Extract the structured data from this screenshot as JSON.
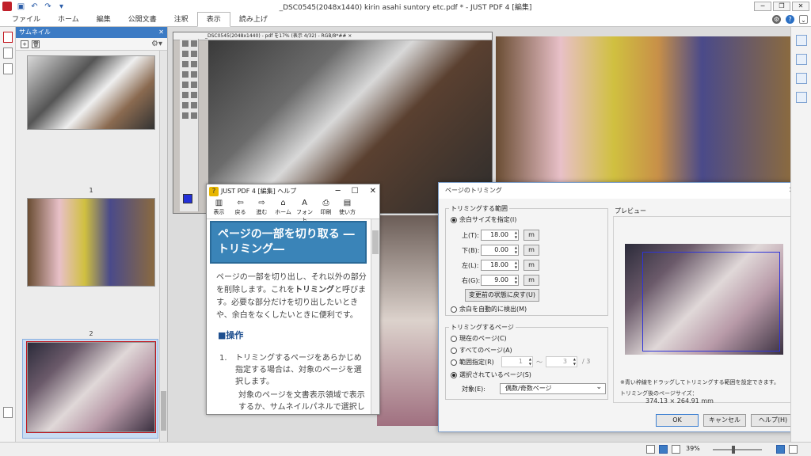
{
  "window": {
    "title": "_DSC0545(2048x1440) kirin asahi suntory etc.pdf * - JUST PDF 4 [編集]"
  },
  "ribbon": {
    "tabs": [
      {
        "label": "ファイル"
      },
      {
        "label": "ホーム"
      },
      {
        "label": "編集"
      },
      {
        "label": "公開文書"
      },
      {
        "label": "注釈"
      },
      {
        "label": "表示"
      },
      {
        "label": "読み上げ"
      }
    ],
    "active_tab": "表示"
  },
  "thumbnail_panel": {
    "title": "サムネイル",
    "pages": [
      {
        "label": "1"
      },
      {
        "label": "2"
      }
    ]
  },
  "image_window": {
    "title": "_DSC0545(2048x1440) - pdf を17% (表示 4/32) - RGB/8*##  ×"
  },
  "help_window": {
    "title": "JUST PDF 4 [編集] ヘルプ",
    "toolbar": [
      "表示",
      "戻る",
      "進む",
      "ホーム",
      "フォント",
      "印刷",
      "使い方"
    ],
    "heading": "ページの一部を切り取る ―トリミング―",
    "intro_pre": "ページの一部を切り出し、それ以外の部分を削除します。これを",
    "intro_bold": "トリミング",
    "intro_post": "と呼びます。必要な部分だけを切り出したいときや、余白をなくしたいときに便利です。",
    "section": "■操作",
    "step_num": "1.",
    "step_text": "トリミングするページをあらかじめ指定する場合は、対象のページを選択します。",
    "sub_text": "対象のページを文書表示領域で表示するか、サムネイルパネルで選択します。→ 詳く"
  },
  "trim_dialog": {
    "title": "ページのトリミング",
    "range_group": "トリミングする範囲",
    "opt_margin": "余白サイズを指定(I)",
    "top_label": "上(T):",
    "top_value": "18.00",
    "bottom_label": "下(B):",
    "bottom_value": "0.00",
    "left_label": "左(L):",
    "left_value": "18.00",
    "right_label": "右(G):",
    "right_value": "9.00",
    "unit": "m",
    "reset_button": "変更前の状態に戻す(U)",
    "opt_auto": "余白を自動的に検出(M)",
    "pages_group": "トリミングするページ",
    "opt_current": "現在のページ(C)",
    "opt_all": "すべてのページ(A)",
    "opt_range": "範囲指定(R)",
    "range_from": "1",
    "range_tilde": "～",
    "range_to": "3",
    "range_total": "/ 3",
    "opt_selected": "選択されているページ(S)",
    "target_label": "対象(E):",
    "target_value": "偶数/奇数ページ",
    "preview_label": "プレビュー",
    "hint": "※青い枠線をドラッグしてトリミングする範囲を設定できます。",
    "size_label": "トリミング後のページサイズ：",
    "size_value": "374.13 × 264.91 mm",
    "ok": "OK",
    "cancel": "キャンセル",
    "help": "ヘルプ(H)"
  },
  "status_bar": {
    "zoom": "39%"
  }
}
